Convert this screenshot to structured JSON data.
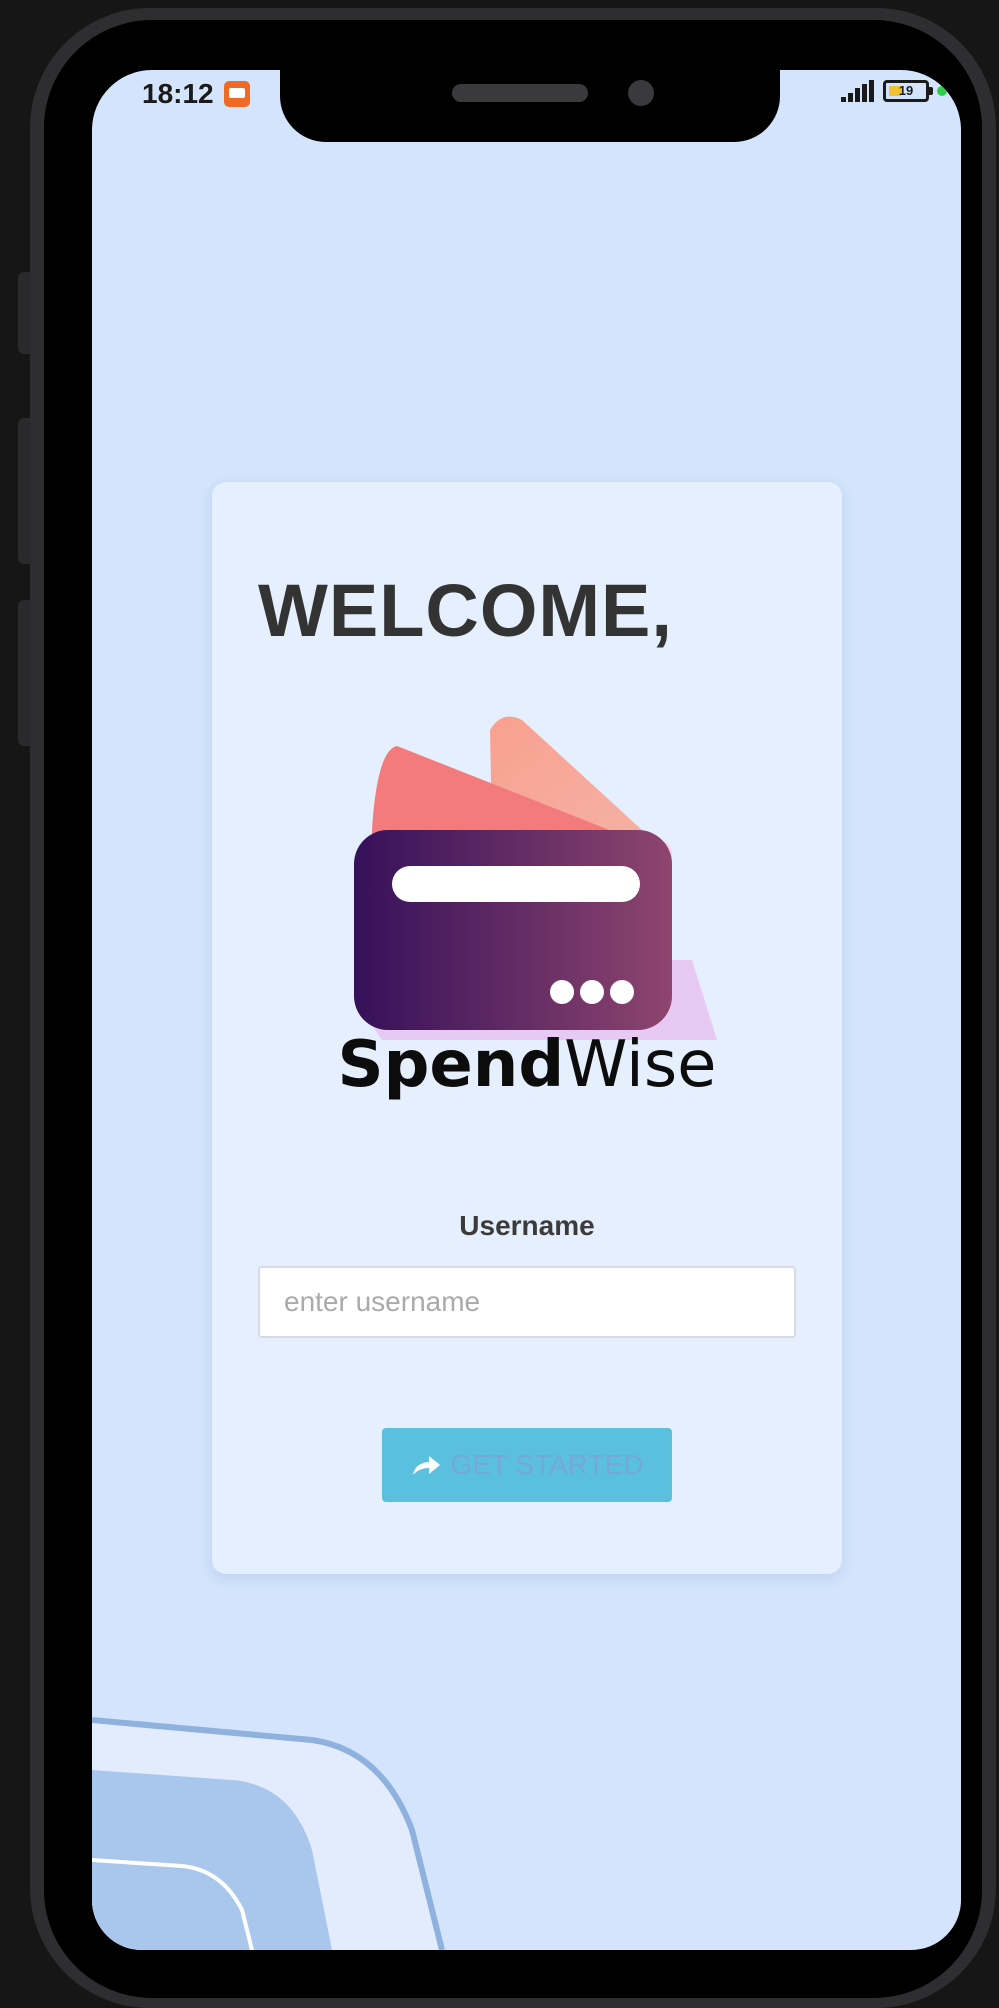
{
  "status_bar": {
    "time": "18:12",
    "battery": "19"
  },
  "card": {
    "welcome": "WELCOME,",
    "logo_text_bold": "Spend",
    "logo_text_light": "Wise",
    "username_label": "Username",
    "username_placeholder": "enter username",
    "username_value": "",
    "start_button_label": "GET STARTED"
  },
  "colors": {
    "screen_bg": "#d3e4fc",
    "card_bg": "#e6effd",
    "button_bg": "#5bc0de",
    "button_text": "#74a8d9",
    "wallet_dark": "#3a0e5c",
    "wallet_light": "#8e456e",
    "card_pink": "#f47b7b"
  },
  "icons": {
    "notification": "notification-icon",
    "signal": "signal-icon",
    "battery": "battery-icon",
    "button": "share-arrow-icon"
  }
}
